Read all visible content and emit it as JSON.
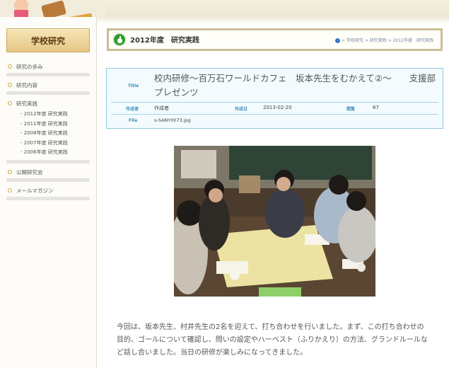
{
  "sidebar": {
    "title": "学校研究",
    "items": [
      {
        "label": "研究の歩み"
      },
      {
        "label": "研究内容"
      },
      {
        "label": "研究実践"
      }
    ],
    "sub_items": [
      {
        "label": "- 2012年度 研究実践"
      },
      {
        "label": "- 2011年度 研究実践"
      },
      {
        "label": "- 2008年度 研究実践"
      },
      {
        "label": "- 2007年度 研究実践"
      },
      {
        "label": "- 2006年度 研究実践"
      }
    ],
    "items_after": [
      {
        "label": "公開研究会"
      },
      {
        "label": "メールマガジン"
      }
    ]
  },
  "header": {
    "title": "2012年度　研究実践",
    "breadcrumb": "> 学校研究 > 研究実践 > 2012年度　研究実践"
  },
  "post": {
    "title_label": "Title",
    "title": "校内研修〜百万石ワールドカフェ　坂本先生をむかえて②〜　　支援部プレゼンツ",
    "author_label": "作成者",
    "author": "作成者",
    "date_label": "作成日",
    "date": "2013-02-20",
    "views_label": "閲覧",
    "views": "67",
    "file_label": "File",
    "file": "s-SANY0073.jpg"
  },
  "body": {
    "text": "今回は、坂本先生、村井先生の2名を迎えて、打ち合わせを行いました。まず、この打ち合わせの目的、ゴールについて確認し、問いの設定やハーベスト（ふりかえり）の方法、グランドルールなど話し合いました。当日の研修が楽しみになってきました。"
  }
}
